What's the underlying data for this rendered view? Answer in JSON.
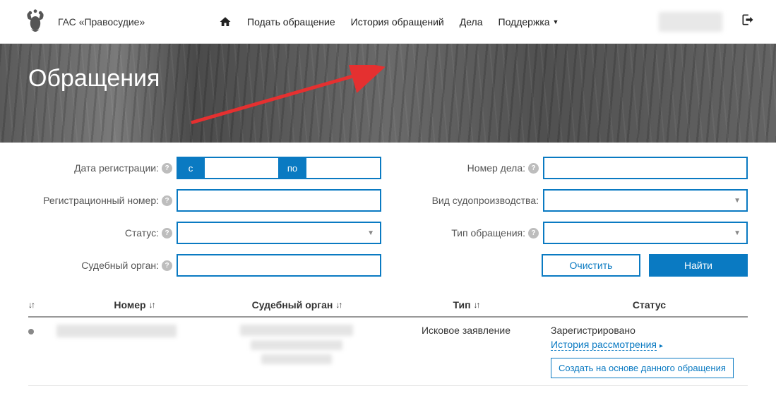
{
  "header": {
    "brand": "ГАС «Правосудие»",
    "nav": {
      "submit": "Подать обращение",
      "history": "История обращений",
      "cases": "Дела",
      "support": "Поддержка"
    }
  },
  "banner": {
    "title": "Обращения"
  },
  "filters": {
    "date_reg": "Дата регистрации:",
    "date_from": "с",
    "date_to": "по",
    "reg_num": "Регистрационный номер:",
    "status": "Статус:",
    "court": "Судебный орган:",
    "case_num": "Номер дела:",
    "proc_type": "Вид судопроизводства:",
    "appeal_type": "Тип обращения:",
    "clear": "Очистить",
    "find": "Найти"
  },
  "table": {
    "col_num": "Номер",
    "col_court": "Судебный орган",
    "col_type": "Тип",
    "col_status": "Статус",
    "rows": [
      {
        "type": "Исковое заявление",
        "status": "Зарегистрировано",
        "history_link": "История рассмотрения",
        "create_btn": "Создать на основе данного обращения"
      }
    ]
  }
}
